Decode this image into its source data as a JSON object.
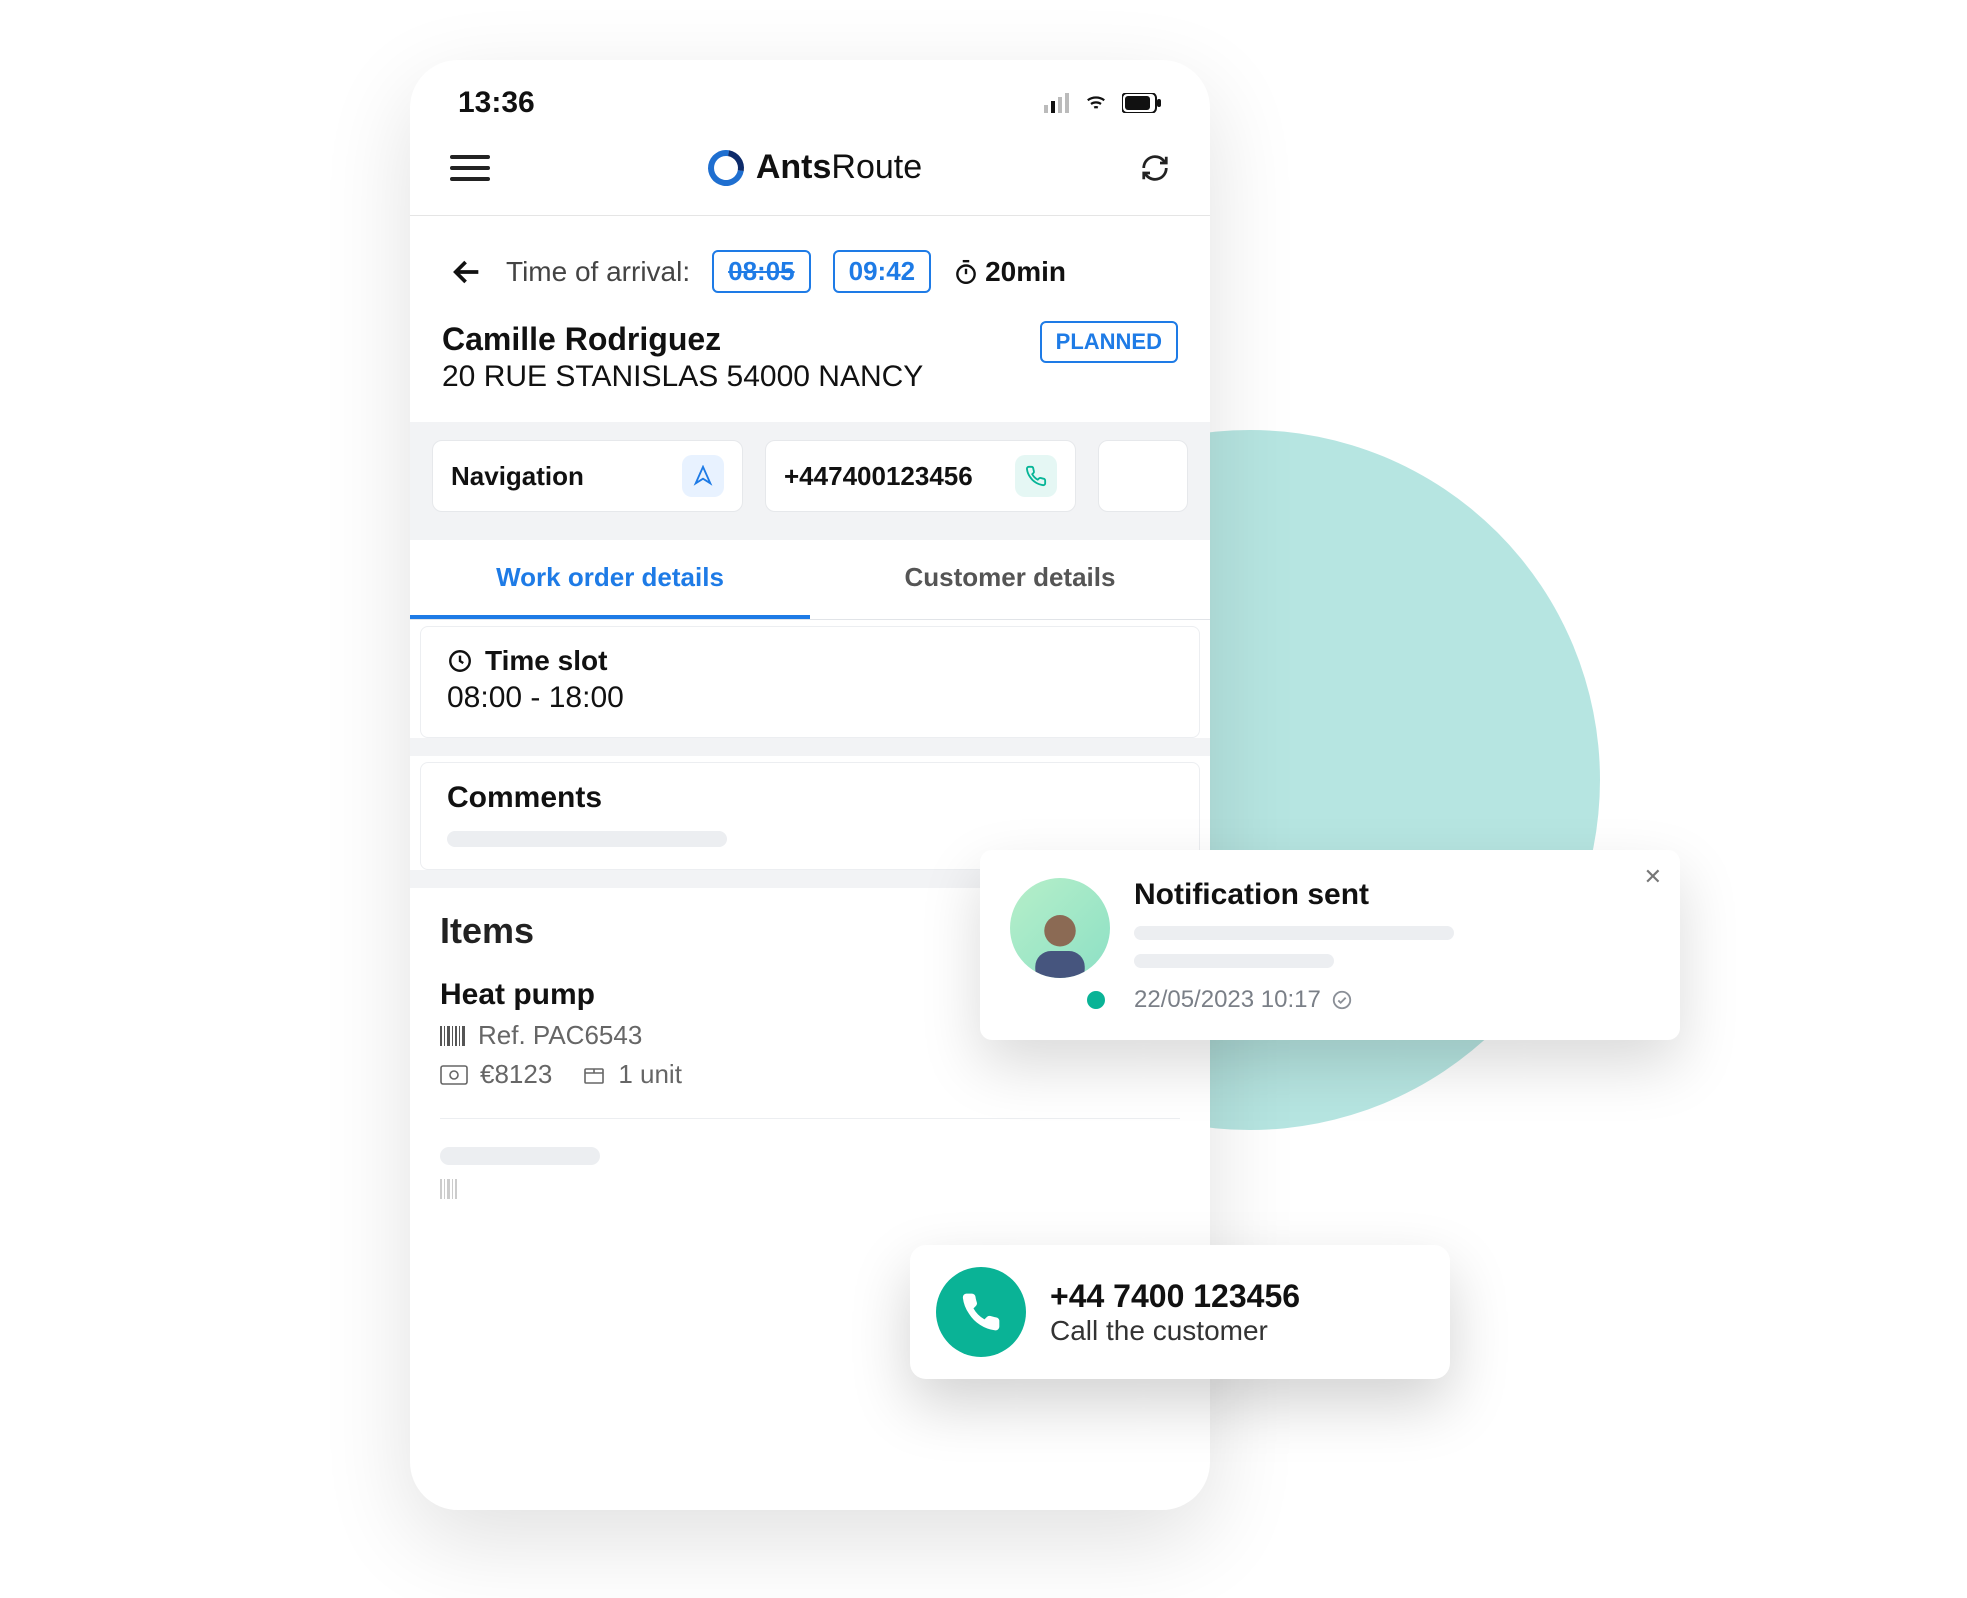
{
  "status": {
    "time": "13:36"
  },
  "app": {
    "name_bold": "Ants",
    "name_thin": "Route"
  },
  "arrival": {
    "label": "Time of arrival:",
    "eta_old": "08:05",
    "eta_new": "09:42",
    "duration": "20min"
  },
  "customer": {
    "name": "Camille Rodriguez",
    "address": "20 RUE STANISLAS 54000 NANCY",
    "status": "PLANNED"
  },
  "cards": {
    "navigation": "Navigation",
    "phone": "+447400123456"
  },
  "tabs": {
    "work": "Work order details",
    "cust": "Customer details"
  },
  "timeslot": {
    "head": "Time slot",
    "value": "08:00 - 18:00"
  },
  "comments": {
    "head": "Comments"
  },
  "items": {
    "head": "Items",
    "list": [
      {
        "name": "Heat pump",
        "ref": "Ref. PAC6543",
        "price": "€8123",
        "qty": "1 unit"
      }
    ]
  },
  "notif": {
    "title": "Notification sent",
    "ts": "22/05/2023 10:17"
  },
  "call": {
    "number": "+44 7400 123456",
    "label": "Call the customer"
  }
}
